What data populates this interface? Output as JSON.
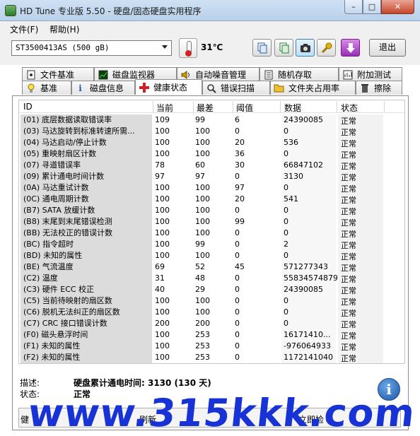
{
  "window": {
    "title": "HD Tune 专业版 5.50 - 硬盘/固态硬盘实用程序",
    "min_label": "–",
    "max_label": "□",
    "close_label": "✕"
  },
  "menu": {
    "file": "文件(F)",
    "help": "帮助(H)"
  },
  "toolbar": {
    "drive": "ST3500413AS (500 gB)",
    "temperature": "31℃",
    "exit_label": "退出"
  },
  "tabs_row1": [
    {
      "label": "文件基准",
      "icon": "file-benchmark-icon"
    },
    {
      "label": "磁盘监视器",
      "icon": "disk-monitor-icon"
    },
    {
      "label": "自动噪音管理",
      "icon": "speaker-icon"
    },
    {
      "label": "随机存取",
      "icon": "random-access-icon"
    },
    {
      "label": "附加测试",
      "icon": "extra-tests-icon"
    }
  ],
  "tabs_row2": [
    {
      "label": "基准",
      "icon": "benchmark-icon"
    },
    {
      "label": "磁盘信息",
      "icon": "info-icon"
    },
    {
      "label": "健康状态",
      "icon": "health-cross-icon",
      "active": true
    },
    {
      "label": "错误扫描",
      "icon": "error-scan-icon"
    },
    {
      "label": "文件夹占用率",
      "icon": "folder-icon"
    },
    {
      "label": "擦除",
      "icon": "trash-icon"
    }
  ],
  "table": {
    "headers": [
      "ID",
      "当前",
      "最差",
      "阈值",
      "数据",
      "状态"
    ],
    "rows": [
      {
        "id": "(01) 底层数据读取错误率",
        "cur": "109",
        "worst": "99",
        "thr": "6",
        "data": "24390085",
        "status": "正常"
      },
      {
        "id": "(03) 马达旋转到标准转速所需...",
        "cur": "100",
        "worst": "100",
        "thr": "0",
        "data": "0",
        "status": "正常"
      },
      {
        "id": "(04) 马达启动/停止计数",
        "cur": "100",
        "worst": "100",
        "thr": "20",
        "data": "536",
        "status": "正常"
      },
      {
        "id": "(05) 重映射扇区计数",
        "cur": "100",
        "worst": "100",
        "thr": "36",
        "data": "0",
        "status": "正常"
      },
      {
        "id": "(07) 寻道错误率",
        "cur": "78",
        "worst": "60",
        "thr": "30",
        "data": "66847102",
        "status": "正常"
      },
      {
        "id": "(09) 累计通电时间计数",
        "cur": "97",
        "worst": "97",
        "thr": "0",
        "data": "3130",
        "status": "正常"
      },
      {
        "id": "(0A) 马达重试计数",
        "cur": "100",
        "worst": "100",
        "thr": "97",
        "data": "0",
        "status": "正常"
      },
      {
        "id": "(0C) 通电周期计数",
        "cur": "100",
        "worst": "100",
        "thr": "20",
        "data": "541",
        "status": "正常"
      },
      {
        "id": "(B7) SATA 放缓计数",
        "cur": "100",
        "worst": "100",
        "thr": "0",
        "data": "0",
        "status": "正常"
      },
      {
        "id": "(B8) 末尾到末尾错误检测",
        "cur": "100",
        "worst": "100",
        "thr": "99",
        "data": "0",
        "status": "正常"
      },
      {
        "id": "(BB) 无法校正的错误计数",
        "cur": "100",
        "worst": "100",
        "thr": "0",
        "data": "0",
        "status": "正常"
      },
      {
        "id": "(BC) 指令超时",
        "cur": "100",
        "worst": "99",
        "thr": "0",
        "data": "2",
        "status": "正常"
      },
      {
        "id": "(BD) 未知的属性",
        "cur": "100",
        "worst": "100",
        "thr": "0",
        "data": "0",
        "status": "正常"
      },
      {
        "id": "(BE) 气流温度",
        "cur": "69",
        "worst": "52",
        "thr": "45",
        "data": "571277343",
        "status": "正常"
      },
      {
        "id": "(C2) 温度",
        "cur": "31",
        "worst": "48",
        "thr": "0",
        "data": "55834574879",
        "status": "正常"
      },
      {
        "id": "(C3) 硬件 ECC 校正",
        "cur": "40",
        "worst": "29",
        "thr": "0",
        "data": "24390085",
        "status": "正常"
      },
      {
        "id": "(C5) 当前待映射的扇区数",
        "cur": "100",
        "worst": "100",
        "thr": "0",
        "data": "0",
        "status": "正常"
      },
      {
        "id": "(C6) 脱机无法纠正的扇区数",
        "cur": "100",
        "worst": "100",
        "thr": "0",
        "data": "0",
        "status": "正常"
      },
      {
        "id": "(C7) CRC 接口错误计数",
        "cur": "200",
        "worst": "200",
        "thr": "0",
        "data": "0",
        "status": "正常"
      },
      {
        "id": "(F0) 磁头悬浮时间",
        "cur": "100",
        "worst": "253",
        "thr": "0",
        "data": "16171410...",
        "status": "正常"
      },
      {
        "id": "(F1) 未知的属性",
        "cur": "100",
        "worst": "253",
        "thr": "0",
        "data": "-976064933",
        "status": "正常"
      },
      {
        "id": "(F2) 未知的属性",
        "cur": "100",
        "worst": "253",
        "thr": "0",
        "data": "1172141040",
        "status": "正常"
      }
    ]
  },
  "details": {
    "desc_label": "描述:",
    "desc_value": "硬盘累计通电时间: 3130 (130 天)",
    "status_label": "状态:",
    "status_value": "正常"
  },
  "bottom": {
    "left_text": "健",
    "refresh_text": "刷新",
    "now_text": "立即检"
  },
  "watermark": "www.315kkk.com",
  "colors": {
    "titlebar": "#c4d8ee",
    "close_button": "#c5452c",
    "watermark": "#1733d6",
    "health_cross": "#d21f1f"
  }
}
